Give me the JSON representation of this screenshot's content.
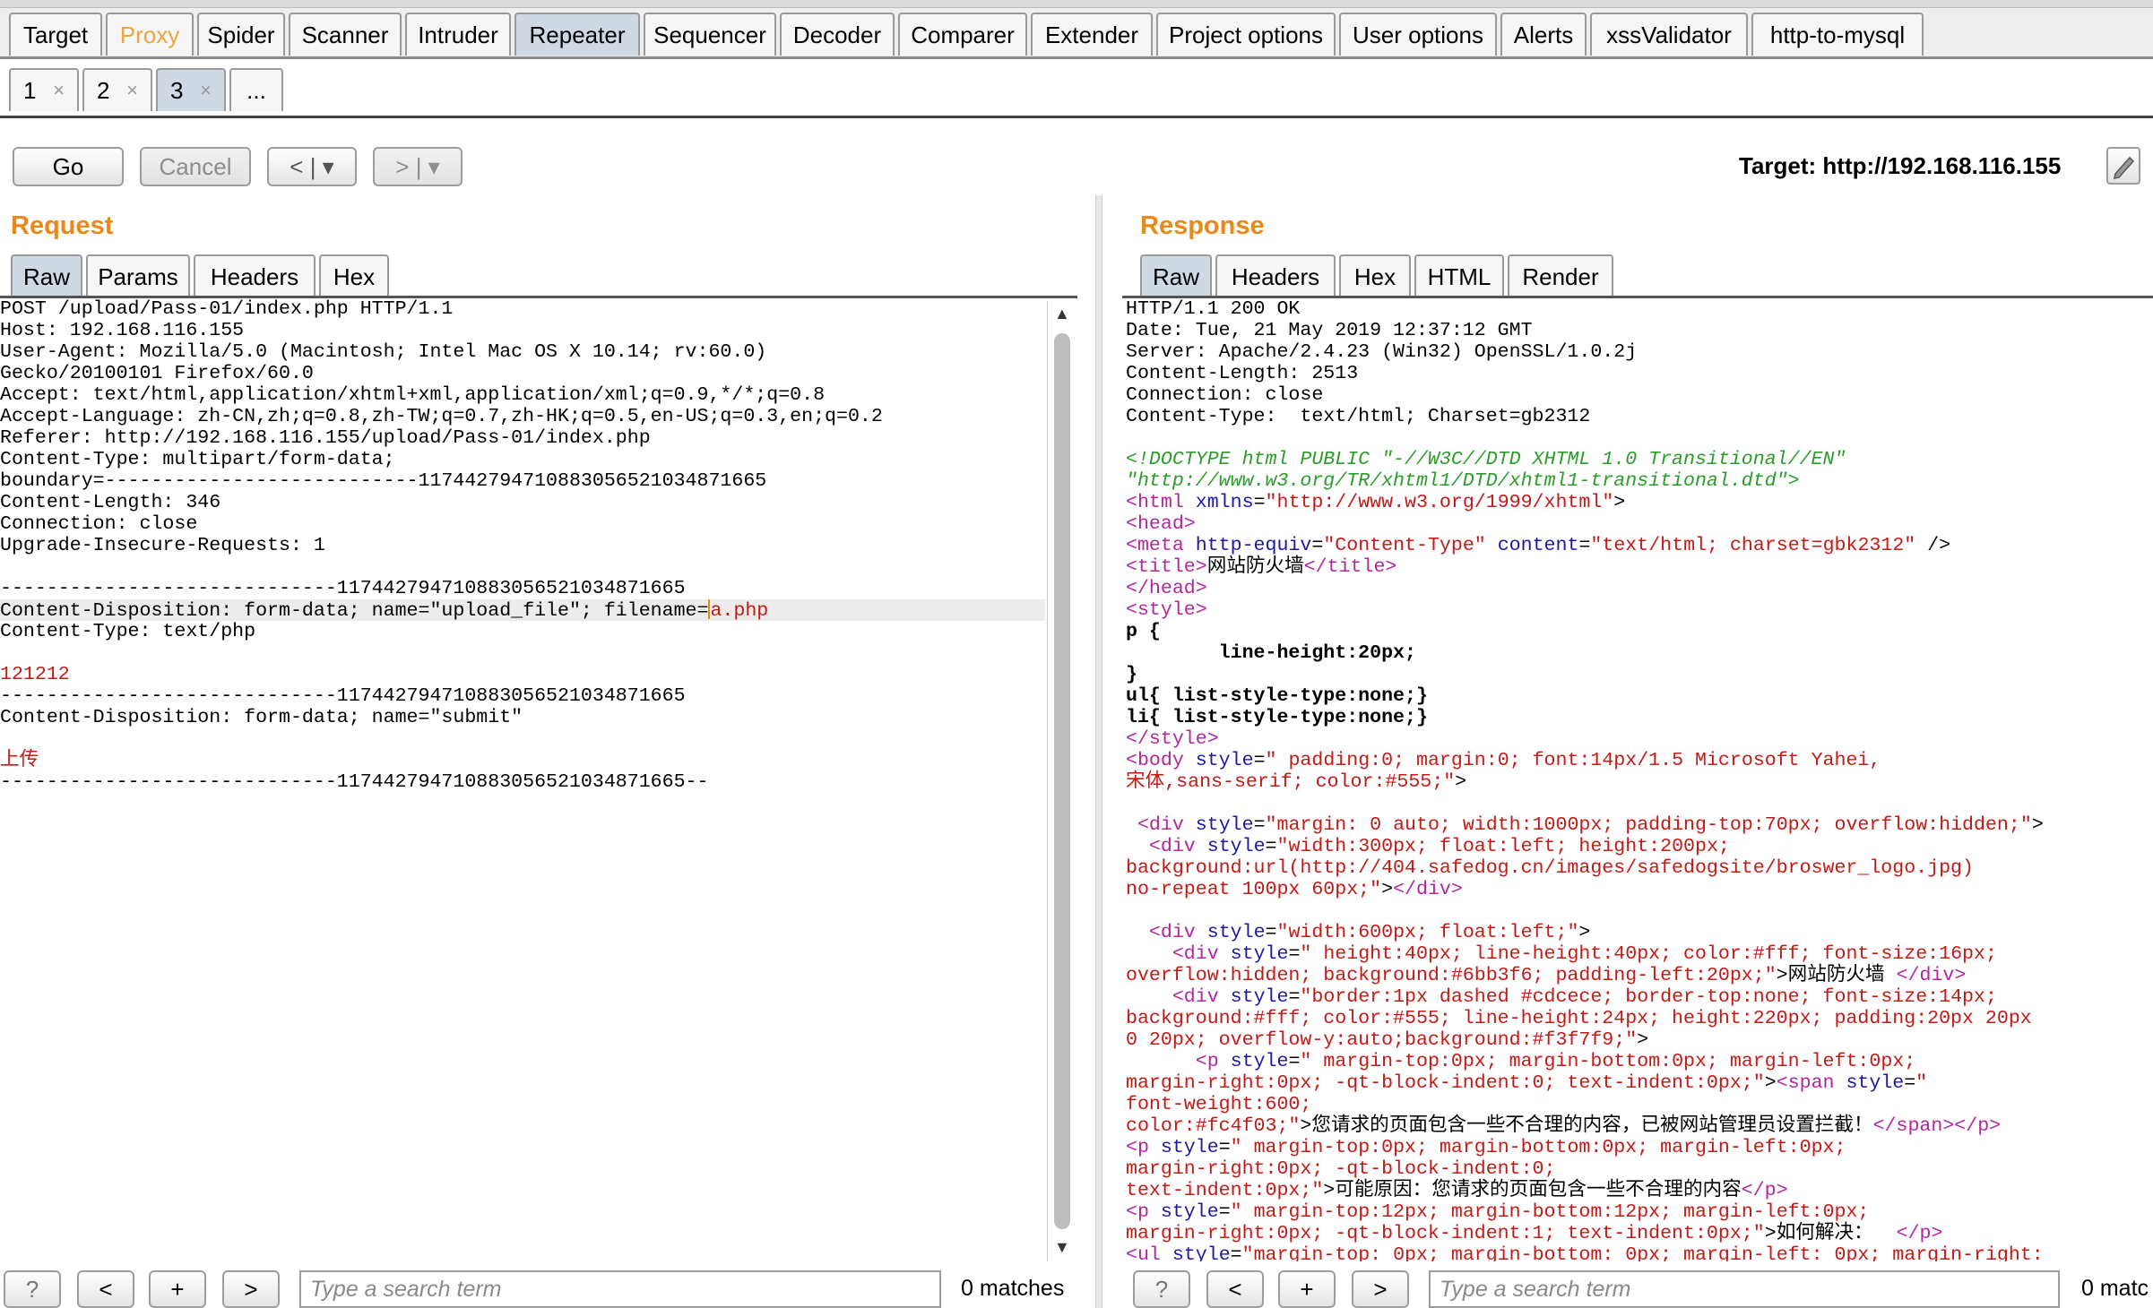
{
  "main_tabs": [
    "Target",
    "Proxy",
    "Spider",
    "Scanner",
    "Intruder",
    "Repeater",
    "Sequencer",
    "Decoder",
    "Comparer",
    "Extender",
    "Project options",
    "User options",
    "Alerts",
    "xssValidator",
    "http-to-mysql"
  ],
  "sub_tabs": [
    {
      "label": "1",
      "close": "×"
    },
    {
      "label": "2",
      "close": "×"
    },
    {
      "label": "3",
      "close": "×"
    },
    {
      "label": "..."
    }
  ],
  "toolbar": {
    "go": "Go",
    "cancel": "Cancel",
    "back": "< | ▾",
    "forward": "> | ▾",
    "target": "Target: http://192.168.116.155"
  },
  "request": {
    "title": "Request",
    "tabs": [
      "Raw",
      "Params",
      "Headers",
      "Hex"
    ],
    "lines": [
      "POST /upload/Pass-01/index.php HTTP/1.1",
      "Host: 192.168.116.155",
      "User-Agent: Mozilla/5.0 (Macintosh; Intel Mac OS X 10.14; rv:60.0)",
      "Gecko/20100101 Firefox/60.0",
      "Accept: text/html,application/xhtml+xml,application/xml;q=0.9,*/*;q=0.8",
      "Accept-Language: zh-CN,zh;q=0.8,zh-TW;q=0.7,zh-HK;q=0.5,en-US;q=0.3,en;q=0.2",
      "Referer: http://192.168.116.155/upload/Pass-01/index.php",
      "Content-Type: multipart/form-data;",
      "boundary=---------------------------117442794710883056521034871665",
      "Content-Length: 346",
      "Connection: close",
      "Upgrade-Insecure-Requests: 1",
      "",
      "-----------------------------117442794710883056521034871665",
      "Content-Disposition: form-data; name=\"upload_file\"; filename=",
      "Content-Type: text/php",
      "",
      "121212",
      "-----------------------------117442794710883056521034871665",
      "Content-Disposition: form-data; name=\"submit\"",
      "",
      "上传",
      "-----------------------------117442794710883056521034871665--"
    ],
    "filename_value": "a.php",
    "submit_value": "submit",
    "search_placeholder": "Type a search term",
    "matches": "0 matches"
  },
  "response": {
    "title": "Response",
    "tabs": [
      "Raw",
      "Headers",
      "Hex",
      "HTML",
      "Render"
    ],
    "headers": [
      "HTTP/1.1 200 OK",
      "Date: Tue, 21 May 2019 12:37:12 GMT",
      "Server: Apache/2.4.23 (Win32) OpenSSL/1.0.2j",
      "Content-Length: 2513",
      "Connection: close",
      "Content-Type:  text/html; Charset=gb2312"
    ],
    "doctype_1": "<!DOCTYPE html PUBLIC \"-//W3C//DTD XHTML 1.0 Transitional//EN\"",
    "doctype_2": "\"http://www.w3.org/TR/xhtml1/DTD/xhtml1-transitional.dtd\">",
    "xmlns": "\"http://www.w3.org/1999/xhtml\"",
    "meta_equiv": "\"Content-Type\"",
    "meta_content": "\"text/html; charset=gbk2312\"",
    "page_title": "网站防火墙",
    "css_1": "        line-height:20px;",
    "css_2": "ul{ list-style-type:none;}",
    "css_3": "li{ list-style-type:none;}",
    "body_style_1": "\" padding:0; margin:0; font:14px/1.5 Microsoft Yahei,",
    "body_style_2": "宋体,sans-serif; color:#555;\"",
    "div1_style": "\"margin: 0 auto; width:1000px; padding-top:70px; overflow:hidden;\"",
    "div2_style_1": "\"width:300px; float:left; height:200px;",
    "div2_style_2": "background:url(http://404.safedog.cn/images/safedogsite/broswer_logo.jpg)",
    "div2_style_3": "no-repeat 100px 60px;\"",
    "div3_style": "\"width:600px; float:left;\"",
    "div4_style_1": "\" height:40px; line-height:40px; color:#fff; font-size:16px;",
    "div4_style_2": "overflow:hidden; background:#6bb3f6; padding-left:20px;\"",
    "div4_text": "网站防火墙 ",
    "div5_style_1": "\"border:1px dashed #cdcece; border-top:none; font-size:14px;",
    "div5_style_2": "background:#fff; color:#555; line-height:24px; height:220px; padding:20px 20px",
    "div5_style_3": "0 20px; overflow-y:auto;background:#f3f7f9;\"",
    "p1_style_1": "\" margin-top:0px; margin-bottom:0px; margin-left:0px;",
    "p1_style_2": "margin-right:0px; -qt-block-indent:0; text-indent:0px;\"",
    "span_style_1": "\"",
    "span_style_2": "font-weight:600;",
    "span_style_3": "color:#fc4f03;\"",
    "span_text": "您请求的页面包含一些不合理的内容，已被网站管理员设置拦截！",
    "p2_style_1": "\" margin-top:0px; margin-bottom:0px; margin-left:0px;",
    "p2_style_2": "margin-right:0px; -qt-block-indent:0;",
    "p2_style_3": "text-indent:0px;\"",
    "p2_text": "可能原因：您请求的页面包含一些不合理的内容",
    "p3_style_1": "\" margin-top:12px; margin-bottom:12px; margin-left:0px;",
    "p3_style_2": "margin-right:0px; -qt-block-indent:1; text-indent:0px;\"",
    "p3_text": "如何解决：  ",
    "ul_partial": "\"margin-top: 0px; margin-bottom: 0px; margin-left: 0px; margin-right:",
    "search_placeholder": "Type a search term",
    "matches": "0 matc"
  },
  "colors": {
    "accent_orange": "#e8891a",
    "active_tab": "#cfd9e3",
    "tag_purple": "#b3269e",
    "attr_blue": "#1a1aa6",
    "value_red": "#c41a16",
    "comment_green": "#2a9d2a"
  }
}
